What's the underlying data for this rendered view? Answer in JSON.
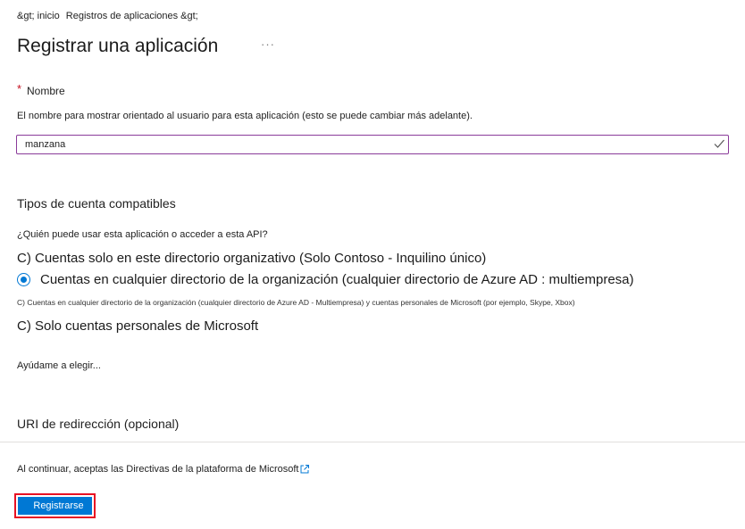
{
  "breadcrumb": {
    "home": "&gt; inicio",
    "app_registrations": "Registros de aplicaciones &gt;"
  },
  "page": {
    "title": "Registrar una aplicación",
    "more": "···"
  },
  "name_field": {
    "required_mark": "*",
    "label": "Nombre",
    "help": "El nombre para mostrar orientado al usuario para esta aplicación (esto se puede cambiar más adelante).",
    "value": "manzana",
    "valid_icon": "check-icon"
  },
  "account_types": {
    "title": "Tipos de cuenta compatibles",
    "question": "¿Quién puede usar esta aplicación o acceder a esta API?",
    "option_single_tenant": "C) Cuentas solo en este directorio organizativo (Solo Contoso - Inquilino único)",
    "option_multitenant": "Cuentas en cualquier directorio de la organización (cualquier directorio de Azure AD : multiempresa)",
    "option_multitenant_personal": "C) Cuentas en cualquier directorio de la organización (cualquier directorio de Azure AD - Multiempresa) y cuentas personales de Microsoft (por ejemplo, Skype, Xbox)",
    "option_personal": "C) Solo cuentas personales de Microsoft",
    "selected": "option_multitenant",
    "help_link": "Ayúdame a elegir..."
  },
  "redirect": {
    "title": "URI de redirección (opcional)"
  },
  "footer": {
    "terms": "Al continuar, aceptas las Directivas de la plataforma de Microsoft",
    "external_icon": "external-link-icon",
    "register_label": "Registrarse"
  },
  "colors": {
    "accent": "#0078d4",
    "highlight_border": "#e81123",
    "input_border": "#8a3b9a"
  }
}
